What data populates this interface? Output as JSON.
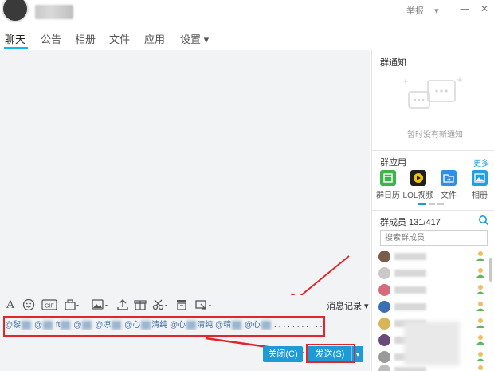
{
  "window": {
    "report_label": "举报",
    "report_caret": "▾",
    "minimize": "—",
    "close": "✕"
  },
  "tabs": [
    {
      "label": "聊天",
      "active": true
    },
    {
      "label": "公告"
    },
    {
      "label": "相册"
    },
    {
      "label": "文件"
    },
    {
      "label": "应用"
    },
    {
      "label": "设置 ▾"
    }
  ],
  "toolbar": {
    "history_label": "消息记录 ▾"
  },
  "input": {
    "segments": [
      "@黎",
      "@",
      "ft",
      "@",
      "@凉",
      "@心",
      "清纯",
      "@心",
      "清纯",
      "@精",
      "@心",
      "..........."
    ]
  },
  "actions": {
    "close_label": "关闭(C)",
    "send_label": "发送(S)",
    "send_arrow": "▾"
  },
  "right_panel": {
    "notice_title": "群通知",
    "notice_empty": "暂时没有新通知",
    "apps_title": "群应用",
    "apps_more": "更多",
    "apps": [
      {
        "label": "群日历",
        "icon": "calendar-icon",
        "color": "#3cb44b"
      },
      {
        "label": "LOL视频",
        "icon": "video-play-icon",
        "color": "#1f1f1f"
      },
      {
        "label": "文件",
        "icon": "file-share-icon",
        "color": "#2f8ee8"
      },
      {
        "label": "相册",
        "icon": "photo-album-icon",
        "color": "#1fa0e0"
      }
    ],
    "members_title": "群成员 131/417",
    "search_placeholder": "搜索群成员",
    "members": [
      {
        "avatar": "#7a5c4a"
      },
      {
        "avatar": "#c9c9c9"
      },
      {
        "avatar": "#d46a7a"
      },
      {
        "avatar": "#3b6fb5"
      },
      {
        "avatar": "#d8b55a"
      },
      {
        "avatar": "#6a4a7a"
      },
      {
        "avatar": "#9a9a9a"
      },
      {
        "avatar": "#bdbdbd"
      }
    ]
  }
}
